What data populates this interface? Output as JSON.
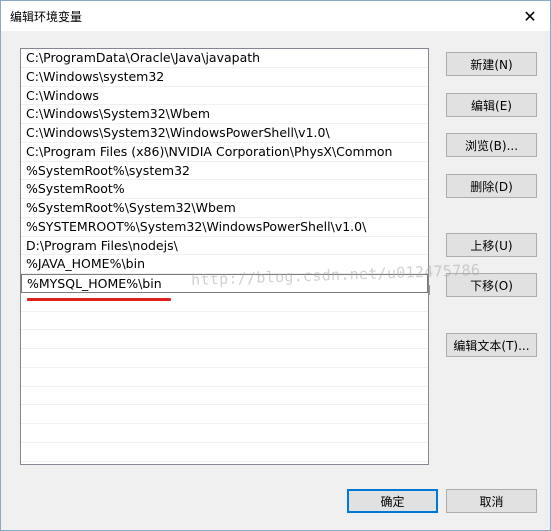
{
  "window": {
    "title": "编辑环境变量"
  },
  "list": {
    "items": [
      "C:\\ProgramData\\Oracle\\Java\\javapath",
      "C:\\Windows\\system32",
      "C:\\Windows",
      "C:\\Windows\\System32\\Wbem",
      "C:\\Windows\\System32\\WindowsPowerShell\\v1.0\\",
      "C:\\Program Files (x86)\\NVIDIA Corporation\\PhysX\\Common",
      "%SystemRoot%\\system32",
      "%SystemRoot%",
      "%SystemRoot%\\System32\\Wbem",
      "%SYSTEMROOT%\\System32\\WindowsPowerShell\\v1.0\\",
      "D:\\Program Files\\nodejs\\",
      "%JAVA_HOME%\\bin",
      "%MYSQL_HOME%\\bin"
    ],
    "empty_rows": 9
  },
  "buttons": {
    "new": "新建(N)",
    "edit": "编辑(E)",
    "browse": "浏览(B)...",
    "delete": "删除(D)",
    "move_up": "上移(U)",
    "move_down": "下移(O)",
    "edit_text": "编辑文本(T)...",
    "ok": "确定",
    "cancel": "取消"
  },
  "watermark": "http://blog.csdn.net/u012475786",
  "colors": {
    "highlight_underline": "#e02020",
    "default_button_border": "#0078d7"
  }
}
